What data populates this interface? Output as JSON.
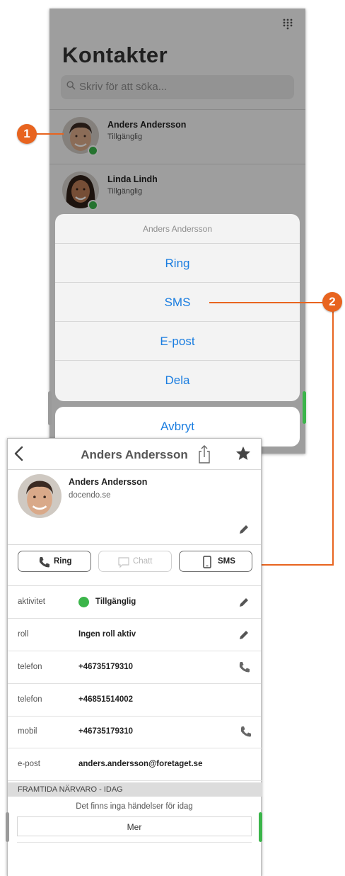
{
  "contacts_screen": {
    "title": "Kontakter",
    "search_placeholder": "Skriv för att söka...",
    "contacts": [
      {
        "name": "Anders Andersson",
        "status": "Tillgänglig"
      },
      {
        "name": "Linda Lindh",
        "status": "Tillgänglig"
      }
    ]
  },
  "action_sheet": {
    "title": "Anders Andersson",
    "options": [
      "Ring",
      "SMS",
      "E-post",
      "Dela"
    ],
    "cancel": "Avbryt"
  },
  "callouts": [
    "1",
    "2"
  ],
  "detail_screen": {
    "title": "Anders Andersson",
    "profile": {
      "name": "Anders Andersson",
      "domain": "docendo.se"
    },
    "actions": {
      "call": "Ring",
      "chat": "Chatt",
      "sms": "SMS"
    },
    "fields": [
      {
        "key": "aktivitet",
        "value": "Tillgänglig"
      },
      {
        "key": "roll",
        "value": "Ingen roll aktiv"
      },
      {
        "key": "telefon",
        "value": "+46735179310"
      },
      {
        "key": "telefon",
        "value": "+46851514002"
      },
      {
        "key": "mobil",
        "value": "+46735179310"
      },
      {
        "key": "e-post",
        "value": "anders.andersson@foretaget.se"
      }
    ],
    "section_header": "FRAMTIDA NÄRVARO - IDAG",
    "no_events": "Det finns inga händelser för idag",
    "more": "Mer"
  },
  "colors": {
    "accent_blue": "#1a7de0",
    "callout_orange": "#e8641f",
    "online_green": "#3bb54a"
  },
  "icons": [
    "keypad-icon",
    "search-icon",
    "back-icon",
    "share-icon",
    "star-icon",
    "pencil-icon",
    "phone-icon",
    "chat-icon",
    "mobile-icon"
  ]
}
